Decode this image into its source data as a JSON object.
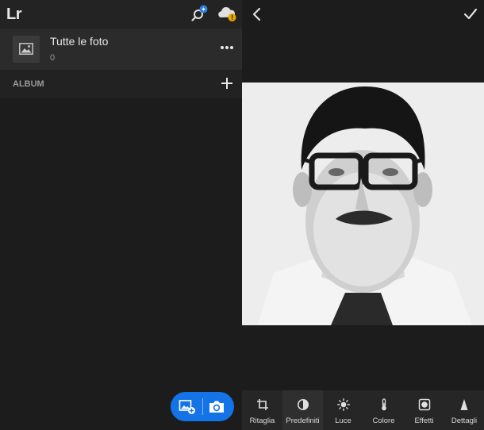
{
  "app": {
    "logo": "Lr"
  },
  "library": {
    "all_photos": {
      "title": "Tutte le foto",
      "count": "0"
    },
    "album_section": {
      "label": "ALBUM"
    },
    "actions": {
      "search_icon": "search-sparkle-icon",
      "cloud_icon": "cloud-warning-icon",
      "add_icon": "plus-icon",
      "more_icon": "more-horizontal-icon"
    },
    "fab": {
      "import_icon": "add-photo-icon",
      "camera_icon": "camera-icon",
      "color": "#1473e6"
    }
  },
  "editor": {
    "back_icon": "chevron-left-icon",
    "done_icon": "checkmark-icon",
    "photo_alt": "black and white portrait photo",
    "tools": [
      {
        "label": "Ritaglia",
        "icon": "crop-icon"
      },
      {
        "label": "Predefiniti",
        "icon": "presets-icon"
      },
      {
        "label": "Luce",
        "icon": "sun-icon"
      },
      {
        "label": "Colore",
        "icon": "thermometer-icon"
      },
      {
        "label": "Effetti",
        "icon": "effects-icon"
      },
      {
        "label": "Dettagli",
        "icon": "triangle-icon"
      }
    ]
  }
}
